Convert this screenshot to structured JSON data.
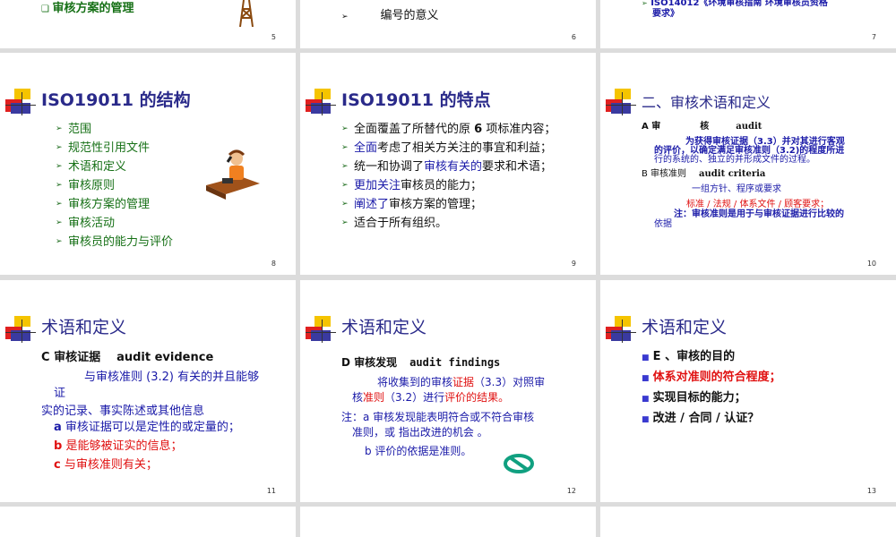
{
  "slides": {
    "s5": {
      "bullet": "审核方案的管理",
      "num": "5"
    },
    "s6": {
      "bullet": "编号的意义",
      "num": "6"
    },
    "s7": {
      "line1": "ISO14012《环境审核指南 环境审核员资格",
      "line2": "要求》",
      "num": "7"
    },
    "s8": {
      "title": "ISO19011 的结构",
      "items": [
        "范围",
        "规范性引用文件",
        "术语和定义",
        "审核原则",
        "审核方案的管理",
        "审核活动",
        "审核员的能力与评价"
      ],
      "num": "8"
    },
    "s9": {
      "title": "ISO19011 的特点",
      "items": [
        {
          "pre": "",
          "hl": "",
          "mid": "全面覆盖了所替代的原 ",
          "strong": "6",
          "post": " 项标准内容；"
        },
        {
          "hl": "全面",
          "post": "考虑了相关方关注的事宜和利益；"
        },
        {
          "pre": "统一和协调了",
          "hl": "审核有关的",
          "post": "要求和术语；"
        },
        {
          "hl": "更加关注",
          "post": "审核员的能力；"
        },
        {
          "hl": "阐述了",
          "post": "审核方案的管理；"
        },
        {
          "post": "适合于所有组织。"
        }
      ],
      "num": "9"
    },
    "s10": {
      "title": "二、审核术语和定义",
      "a_label": "A 审",
      "a_mid": "核",
      "a_en": "audit",
      "a_def1": "为获得审核证据（3.3）并对其进行客观",
      "a_def2": "的评价，以确定满足审核准则（3.2)的程度所进",
      "a_def3": "行的系统的、独立的并形成文件的过程。",
      "b_label": "B 审核准则",
      "b_en": "audit criteria",
      "b_def": "一组方针、程序或要求",
      "b_list": "标准 / 法规 / 体系文件 / 顾客要求；",
      "b_note1": "注：审核准则是用于与审核证据进行比较的",
      "b_note2": "依据",
      "num": "10"
    },
    "s11": {
      "title": "术语和定义",
      "c_label": "C 审核证据",
      "c_en": "audit evidence",
      "def1": "与审核准则 (3.2) 有关的并且能够",
      "def2": "证",
      "def3": "实的记录、事实陈述或其他信息",
      "items": [
        {
          "k": "a",
          "text": "审核证据可以是定性的或定量的；"
        },
        {
          "k": "b",
          "text": "是能够被证实的信息；"
        },
        {
          "k": "c",
          "text": "与审核准则有关；"
        }
      ],
      "num": "11"
    },
    "s12": {
      "title": "术语和定义",
      "d_label": "D 审核发现",
      "d_en": "audit findings",
      "def1a": "将收集到的审核",
      "def1b": "证据",
      "def1c": "（3.3）对照审",
      "def2a": "核",
      "def2b": "准则",
      "def2c": "（3.2）进行",
      "def2d": "评价的结果。",
      "note1": "注：a 审核发现能表明符合或不符合审核",
      "note2": "准则，或 指出改进的机会 。",
      "note3": "b 评价的依据是准则。",
      "num": "12"
    },
    "s13": {
      "title": "术语和定义",
      "items": [
        {
          "text": "E 、审核的目的",
          "color": "#111111"
        },
        {
          "text": "体系对准则的符合程度；",
          "color": "#e01010"
        },
        {
          "text": "实现目标的能力；",
          "color": "#111111"
        },
        {
          "text": "改进 / 合同 / 认证？",
          "color": "#111111"
        }
      ],
      "num": "13"
    }
  },
  "colors": {
    "title": "#2a2a8a",
    "green": "#167016",
    "blue": "#1a1aa8",
    "red": "#e01010"
  },
  "icons": [
    "tower-clipart",
    "phone-person-clipart",
    "no-entry-symbol"
  ]
}
